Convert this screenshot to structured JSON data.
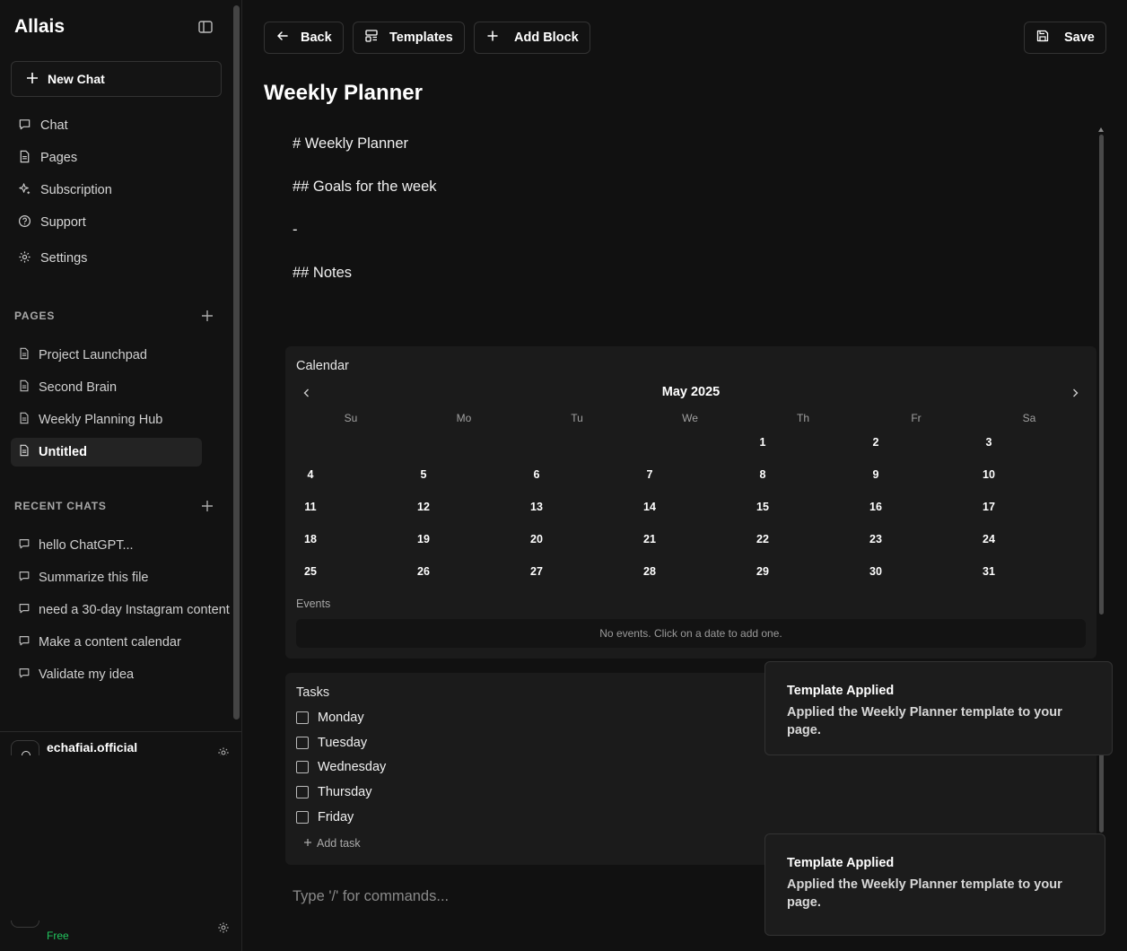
{
  "sidebar": {
    "brand": "Allais",
    "new_chat_label": "New Chat",
    "nav": [
      {
        "label": "Chat",
        "icon": "chat-bubble-icon"
      },
      {
        "label": "Pages",
        "icon": "document-icon"
      },
      {
        "label": "Subscription",
        "icon": "sparkle-icon"
      },
      {
        "label": "Support",
        "icon": "help-circle-icon"
      },
      {
        "label": "Settings",
        "icon": "gear-icon"
      }
    ],
    "pages_heading": "PAGES",
    "pages": [
      {
        "label": "Project Launchpad"
      },
      {
        "label": "Second Brain"
      },
      {
        "label": "Weekly Planning Hub"
      },
      {
        "label": "Untitled",
        "active": true
      }
    ],
    "recent_heading": "RECENT CHATS",
    "recent_chats": [
      {
        "label": "hello ChatGPT..."
      },
      {
        "label": "Summarize this file"
      },
      {
        "label": "need a 30-day Instagram content"
      },
      {
        "label": "Make a content calendar"
      },
      {
        "label": "Validate my idea"
      }
    ],
    "user": {
      "name": "echafiai.official",
      "plan": "Free",
      "plan_color": "#22c55e"
    }
  },
  "toolbar": {
    "back_label": "Back",
    "templates_label": "Templates",
    "add_block_label": "Add Block",
    "save_label": "Save"
  },
  "page": {
    "title": "Weekly Planner",
    "lines": [
      "# Weekly Planner",
      "## Goals for the week",
      "-",
      "## Notes"
    ],
    "command_placeholder": "Type '/' for commands..."
  },
  "calendar": {
    "title": "Calendar",
    "month": "May 2025",
    "weekdays": [
      "Su",
      "Mo",
      "Tu",
      "We",
      "Th",
      "Fr",
      "Sa"
    ],
    "weeks": [
      [
        "",
        "",
        "",
        "",
        "1",
        "2",
        "3"
      ],
      [
        "4",
        "5",
        "6",
        "7",
        "8",
        "9",
        "10"
      ],
      [
        "11",
        "12",
        "13",
        "14",
        "15",
        "16",
        "17"
      ],
      [
        "18",
        "19",
        "20",
        "21",
        "22",
        "23",
        "24"
      ],
      [
        "25",
        "26",
        "27",
        "28",
        "29",
        "30",
        "31"
      ]
    ],
    "events_label": "Events",
    "events_empty": "No events. Click on a date to add one."
  },
  "tasks": {
    "title": "Tasks",
    "items": [
      "Monday",
      "Tuesday",
      "Wednesday",
      "Thursday",
      "Friday"
    ],
    "add_label": "Add task"
  },
  "toasts": [
    {
      "title": "Template Applied",
      "body": "Applied the Weekly Planner template to your page."
    },
    {
      "title": "Template Applied",
      "body": "Applied the Weekly Planner template to your page."
    }
  ]
}
